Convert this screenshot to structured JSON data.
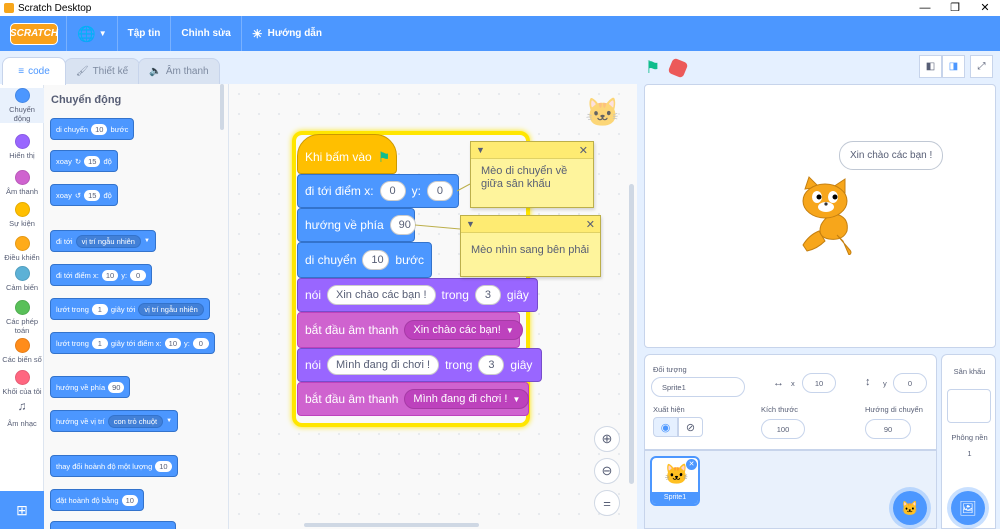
{
  "window": {
    "title": "Scratch Desktop"
  },
  "menubar": {
    "logo": "SCRATCH",
    "items": [
      "Tập tin",
      "Chỉnh sửa"
    ],
    "tutorial": "Hướng dẫn"
  },
  "tabs": {
    "code": "code",
    "costumes": "Thiết kế",
    "sounds": "Âm thanh"
  },
  "categories": [
    {
      "label": "Chuyển động",
      "color": "#4c97ff"
    },
    {
      "label": "Hiển thị",
      "color": "#9966ff"
    },
    {
      "label": "Âm thanh",
      "color": "#cf63cf"
    },
    {
      "label": "Sự kiện",
      "color": "#ffbf00"
    },
    {
      "label": "Điều khiển",
      "color": "#ffab19"
    },
    {
      "label": "Cảm biến",
      "color": "#5cb1d6"
    },
    {
      "label": "Các phép toán",
      "color": "#59c059"
    },
    {
      "label": "Các biến số",
      "color": "#ff8c1a"
    },
    {
      "label": "Khối của tôi",
      "color": "#ff6680"
    },
    {
      "label": "Âm nhạc",
      "color": "#0fbd8c"
    }
  ],
  "palette": {
    "title": "Chuyển động",
    "move": {
      "pre": "di chuyển",
      "val": "10",
      "post": "bước"
    },
    "turn_right": {
      "pre": "xoay",
      "val": "15",
      "post": "độ"
    },
    "turn_left": {
      "pre": "xoay",
      "val": "15",
      "post": "độ"
    },
    "goto": {
      "pre": "đi tới",
      "dd": "vị trí ngẫu nhiên"
    },
    "goto_xy": {
      "pre": "đi tới điểm x:",
      "x": "10",
      "y_label": "y:",
      "y": "0"
    },
    "glide": {
      "pre": "lướt trong",
      "val": "1",
      "mid": "giây tới",
      "dd": "vị trí ngẫu nhiên"
    },
    "glide_xy": {
      "pre": "lướt trong",
      "val": "1",
      "mid": "giây tới điểm x:",
      "x": "10",
      "y_label": "y:",
      "y": "0"
    },
    "point_dir": {
      "pre": "hướng về phía",
      "val": "90"
    },
    "point_towards": {
      "pre": "hướng về vị trí",
      "dd": "con trỏ chuột"
    },
    "change_x": {
      "pre": "thay đổi hoành độ một lượng",
      "val": "10"
    },
    "set_x": {
      "pre": "đặt hoành độ bằng",
      "val": "10"
    }
  },
  "script": {
    "hat": "Khi bấm vào",
    "goto_xy": {
      "pre": "đi tới điểm x:",
      "x": "0",
      "y_label": "y:",
      "y": "0"
    },
    "point": {
      "pre": "hướng về phía",
      "val": "90"
    },
    "move": {
      "pre": "di chuyển",
      "val": "10",
      "post": "bước"
    },
    "say1": {
      "pre": "nói",
      "text": "Xin chào các bạn !",
      "mid": "trong",
      "secs": "3",
      "post": "giây"
    },
    "sound1": {
      "pre": "bắt đầu âm thanh",
      "dd": "Xin chào các bạn!"
    },
    "say2": {
      "pre": "nói",
      "text": "Mình đang đi chơi !",
      "mid": "trong",
      "secs": "3",
      "post": "giây"
    },
    "sound2": {
      "pre": "bắt đầu âm thanh",
      "dd": "Mình đang đi chơi !"
    }
  },
  "comments": {
    "c1": "Mèo di chuyển về giữa sân khấu",
    "c2": "Mèo nhìn sang bên phải"
  },
  "stage": {
    "speech": "Xin chào các bạn !"
  },
  "sprite_info": {
    "sprite_label": "Đối tượng",
    "sprite_name": "Sprite1",
    "x_label": "x",
    "x": "10",
    "y_label": "y",
    "y": "0",
    "show_label": "Xuất hiện",
    "size_label": "Kích thước",
    "size": "100",
    "dir_label": "Hướng di chuyển",
    "direction": "90"
  },
  "sprites": [
    {
      "name": "Sprite1"
    }
  ],
  "stage_panel": {
    "title": "Sân khấu",
    "backdrops_label": "Phông nền",
    "backdrops_count": "1"
  }
}
